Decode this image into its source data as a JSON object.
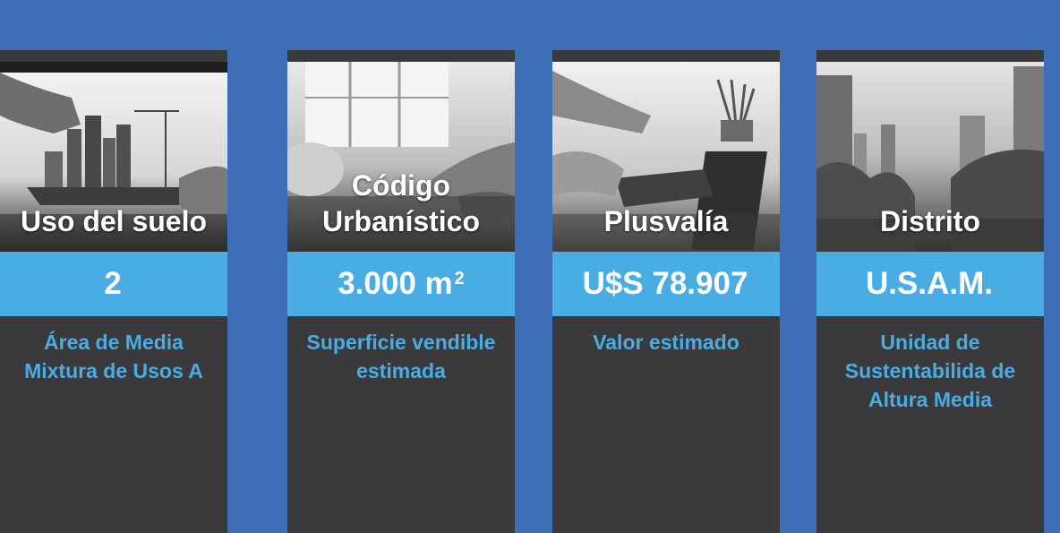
{
  "colors": {
    "background": "#3e6fb7",
    "card": "#3a3a3c",
    "band": "#49ade3",
    "accent_text": "#49ade3"
  },
  "cards": [
    {
      "image_icon": "architect-drawing-photo",
      "title_line1": "Código",
      "title_line2": "Urbanístico",
      "value": "3.000 m",
      "value_sup": "2",
      "desc_line1": "Superficie vendible",
      "desc_line2": "estimada",
      "desc_line3": ""
    },
    {
      "image_icon": "calculator-keyboard-photo",
      "title_line1": "",
      "title_line2": "Plusvalía",
      "value": "U$S 78.907",
      "value_sup": "",
      "desc_line1": "Valor estimado",
      "desc_line2": "",
      "desc_line3": ""
    },
    {
      "image_icon": "city-skyline-photo",
      "title_line1": "",
      "title_line2": "Distrito",
      "value": "U.S.A.M.",
      "value_sup": "",
      "desc_line1": "Unidad de",
      "desc_line2": "Sustentabilida de",
      "desc_line3": "Altura Media"
    },
    {
      "image_icon": "building-model-photo",
      "title_line1": "",
      "title_line2": "Uso del suelo",
      "value": "2",
      "value_sup": "",
      "desc_line1": "Área de Media",
      "desc_line2": "Mixtura de Usos A",
      "desc_line3": ""
    }
  ]
}
